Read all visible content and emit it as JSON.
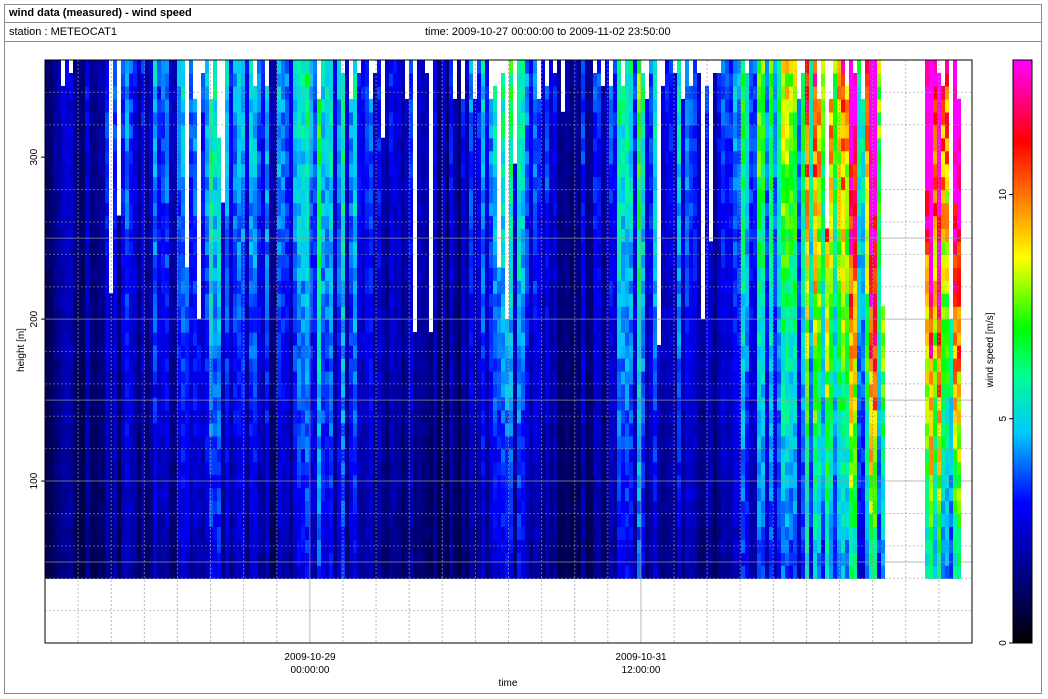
{
  "header": {
    "title": "wind data (measured) - wind speed",
    "station": "station : METEOCAT1",
    "time": "time: 2009-10-27 00:00:00 to 2009-11-02 23:50:00"
  },
  "chart_data": {
    "type": "heatmap",
    "ylabel": "height [m]",
    "xlabel": "time",
    "ylim": [
      0,
      360
    ],
    "yticks": [
      100,
      200,
      300
    ],
    "xticks": [
      {
        "line1": "2009-10-29",
        "line2": "00:00:00"
      },
      {
        "line1": "2009-10-31",
        "line2": "12:00:00"
      }
    ],
    "colorbar": {
      "label": "wind speed [m/s]",
      "range": [
        0,
        13
      ],
      "ticks": [
        0,
        5,
        10
      ],
      "colors": [
        "#000000",
        "#0000ff",
        "#00ffff",
        "#00ff00",
        "#ffff00",
        "#ff0000",
        "#ff00ff"
      ]
    },
    "grid": true,
    "data_height_range_m": [
      40,
      360
    ],
    "wind_speed_profiles": [
      {
        "time": "2009-10-27 00:00",
        "low_m_s": 1.0,
        "high_m_s": 1.5
      },
      {
        "time": "2009-10-27 12:00",
        "low_m_s": 1.6,
        "high_m_s": 3.0
      },
      {
        "time": "2009-10-28 00:00",
        "low_m_s": 1.8,
        "high_m_s": 3.6
      },
      {
        "time": "2009-10-28 06:00",
        "low_m_s": 2.8,
        "high_m_s": 5.8
      },
      {
        "time": "2009-10-28 18:00",
        "low_m_s": 1.5,
        "high_m_s": 3.5
      },
      {
        "time": "2009-10-29 00:00",
        "low_m_s": 2.6,
        "high_m_s": 5.2
      },
      {
        "time": "2009-10-29 08:00",
        "low_m_s": 2.2,
        "high_m_s": 4.2
      },
      {
        "time": "2009-10-30 00:00",
        "low_m_s": 1.0,
        "high_m_s": 2.0
      },
      {
        "time": "2009-10-30 12:00",
        "low_m_s": 2.2,
        "high_m_s": 4.8
      },
      {
        "time": "2009-10-31 00:00",
        "low_m_s": 1.2,
        "high_m_s": 2.2
      },
      {
        "time": "2009-10-31 12:00",
        "low_m_s": 2.6,
        "high_m_s": 5.6
      },
      {
        "time": "2009-11-01 00:00",
        "low_m_s": 1.5,
        "high_m_s": 3.0
      },
      {
        "time": "2009-11-01 12:00",
        "low_m_s": 3.0,
        "high_m_s": 6.5
      },
      {
        "time": "2009-11-02 00:00",
        "low_m_s": 4.5,
        "high_m_s": 11.0
      },
      {
        "time": "2009-11-02 18:00",
        "low_m_s": 4.5,
        "high_m_s": 12.0
      }
    ]
  }
}
